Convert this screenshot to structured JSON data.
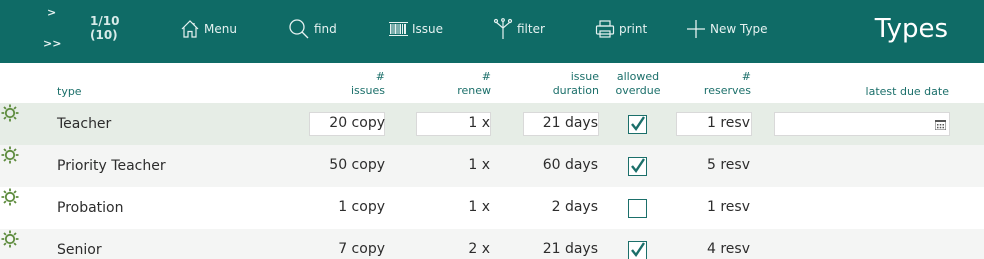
{
  "toolbar": {
    "nav_next": ">",
    "nav_last": ">>",
    "record_position": "1/10",
    "record_total": "(10)",
    "menu_label": "Menu",
    "find_label": "find",
    "issue_label": "Issue",
    "filter_label": "filter",
    "print_label": "print",
    "new_type_label": "New Type",
    "page_title": "Types",
    "background_color": "#0f6b66"
  },
  "table": {
    "headers": {
      "type": "type",
      "issues_top": "#",
      "issues_bottom": "issues",
      "renew_top": "#",
      "renew_bottom": "renew",
      "duration_top": "issue",
      "duration_bottom": "duration",
      "overdue_top": "allowed",
      "overdue_bottom": "overdue",
      "reserves_top": "#",
      "reserves_bottom": "reserves",
      "due_date": "latest due date"
    },
    "rows": [
      {
        "type": "Teacher",
        "issues": "20 copy",
        "renew": "1 x",
        "duration": "21 days",
        "overdue": true,
        "reserves": "1 resv",
        "due_date": ""
      },
      {
        "type": "Priority Teacher",
        "issues": "50 copy",
        "renew": "1 x",
        "duration": "60 days",
        "overdue": true,
        "reserves": "5 resv",
        "due_date": ""
      },
      {
        "type": "Probation",
        "issues": "1 copy",
        "renew": "1 x",
        "duration": "2 days",
        "overdue": false,
        "reserves": "1 resv",
        "due_date": ""
      },
      {
        "type": "Senior",
        "issues": "7 copy",
        "renew": "2 x",
        "duration": "21 days",
        "overdue": true,
        "reserves": "4 resv",
        "due_date": ""
      }
    ]
  },
  "icons": {
    "menu": "home-icon",
    "find": "search-icon",
    "issue": "barcode-icon",
    "filter": "filter-icon",
    "print": "printer-icon",
    "new_type": "plus-icon",
    "row_settings": "gear-icon",
    "due_date": "calendar-icon"
  },
  "colors": {
    "accent": "#1b6f6a",
    "selected_row": "#e6ede6",
    "alt_row": "#f4f5f4"
  }
}
